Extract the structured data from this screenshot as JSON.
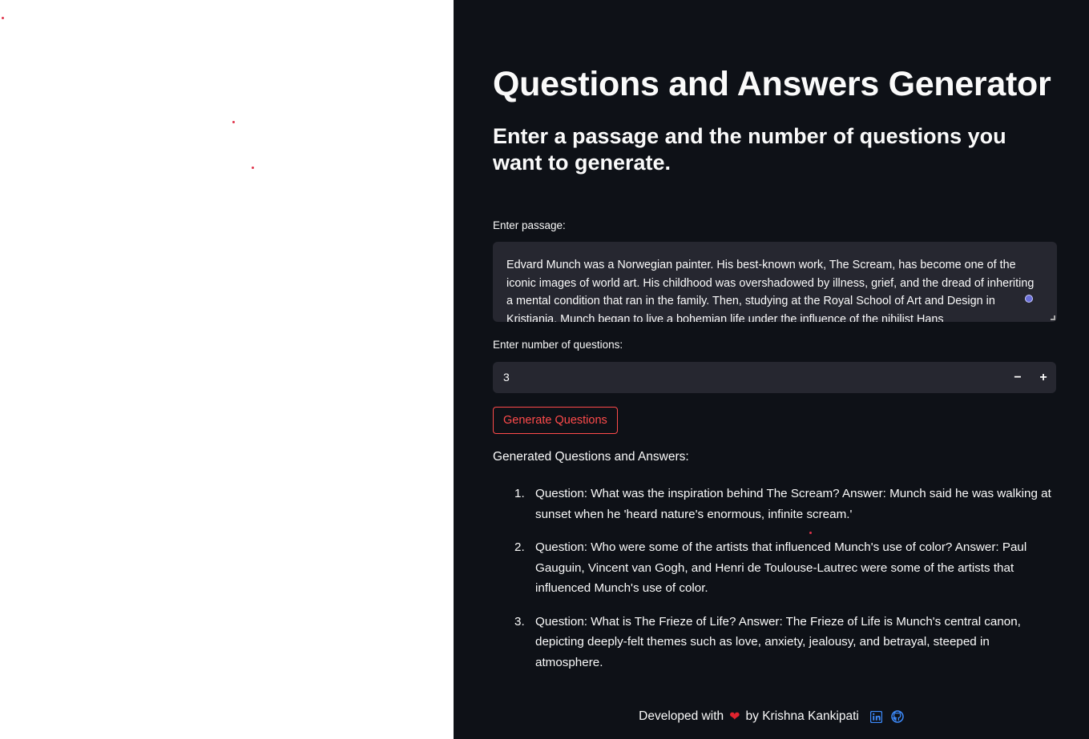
{
  "app": {
    "title": "Questions and Answers Generator",
    "subtitle": "Enter a passage and the number of questions you want to generate."
  },
  "form": {
    "passage_label": "Enter passage:",
    "passage_value": "Edvard Munch was a Norwegian painter. His best-known work, The Scream, has become one of the iconic images of world art. His childhood was overshadowed by illness, grief, and the dread of inheriting a mental condition that ran in the family. Then, studying at the Royal School of Art and Design in Kristiania, Munch began to live a bohemian life under the influence of the nihilist Hans",
    "number_label": "Enter number of questions:",
    "number_value": "3",
    "minus_label": "−",
    "plus_label": "+",
    "generate_button": "Generate Questions"
  },
  "results": {
    "heading": "Generated Questions and Answers:",
    "items": [
      {
        "num": "1.",
        "text": "Question: What was the inspiration behind The Scream? Answer: Munch said he was walking at sunset when he 'heard nature's enormous, infinite scream.'"
      },
      {
        "num": "2.",
        "text": "Question: Who were some of the artists that influenced Munch's use of color? Answer: Paul Gauguin, Vincent van Gogh, and Henri de Toulouse-Lautrec were some of the artists that influenced Munch's use of color."
      },
      {
        "num": "3.",
        "text": "Question: What is The Frieze of Life? Answer: The Frieze of Life is Munch's central canon, depicting deeply-felt themes such as love, anxiety, jealousy, and betrayal, steeped in atmosphere."
      }
    ]
  },
  "footer": {
    "prefix": "Developed with",
    "heart": "❤",
    "suffix": "by Krishna Kankipati",
    "icons": [
      "linkedin-icon",
      "github-icon"
    ]
  },
  "colors": {
    "background": "#0e1117",
    "input_bg": "#262730",
    "accent": "#ff4b4b",
    "text": "#fafafa",
    "link_icon": "#3d8bfd"
  }
}
